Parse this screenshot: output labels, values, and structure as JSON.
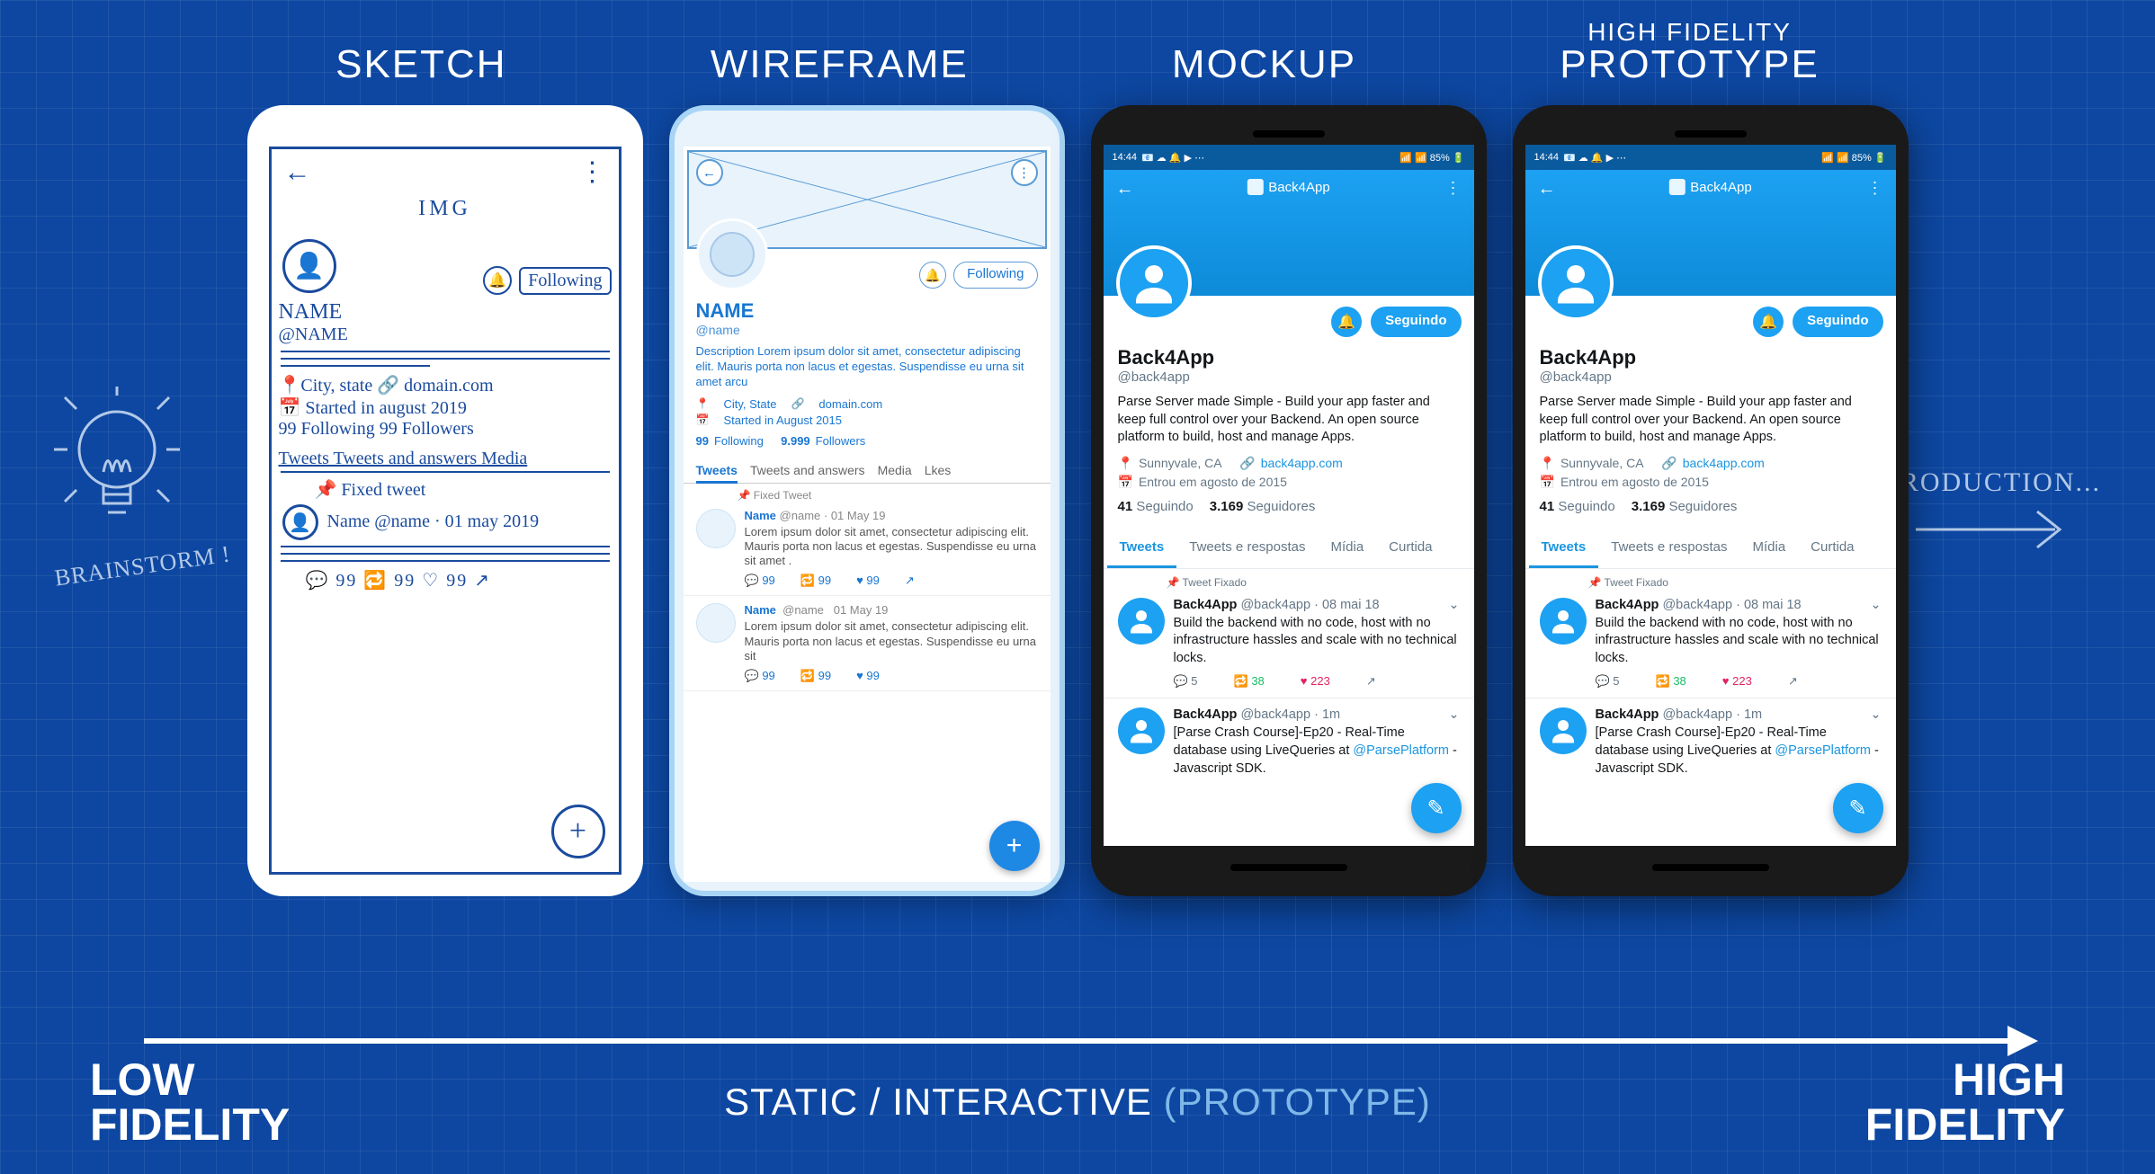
{
  "titles": [
    "SKETCH",
    "WIREFRAME",
    "MOCKUP"
  ],
  "title4_sub": "HIGH FIDELITY",
  "title4_main": "PROTOTYPE",
  "brainstorm_label": "BRAINSTORM !",
  "production_label": "PRODUCTION...",
  "fidelity_low": "LOW\nFIDELITY",
  "fidelity_high": "HIGH\nFIDELITY",
  "mid_static": "STATIC / INTERACTIVE ",
  "mid_proto": "(PROTOTYPE)",
  "sketch": {
    "img": "IMG",
    "name": "NAME",
    "handle": "@NAME",
    "bell": "🔔",
    "follow": "Following",
    "loc": "📍City, state   🔗 domain.com",
    "started": "📅 Started in august 2019",
    "follow_counts": "99 Following   99 Followers",
    "tabs": "Tweets  Tweets and answers  Media",
    "fixed": "📌 Fixed tweet",
    "tweet_meta": "Name  @name · 01 may 2019",
    "stat_row": "💬 99    🔁 99    ♡ 99    ↗"
  },
  "wire": {
    "name": "NAME",
    "handle": "@name",
    "follow": "Following",
    "desc": "Description Lorem ipsum dolor sit amet, consectetur adipiscing elit. Mauris porta non lacus et egestas. Suspendisse eu urna sit amet arcu",
    "loc": "City, State",
    "domain": "domain.com",
    "started": "Started in August 2015",
    "following_n": "99",
    "following_l": "Following",
    "followers_n": "9.999",
    "followers_l": "Followers",
    "tabs": [
      "Tweets",
      "Tweets and answers",
      "Media",
      "Lkes"
    ],
    "fixed": "📌  Fixed Tweet",
    "tweet_name": "Name",
    "tweet_handle": "@name · 01 May 19",
    "tweet_body": "Lorem ipsum dolor sit amet, consectetur adipiscing elit. Mauris porta non lacus et egestas. Suspendisse eu urna sit amet .",
    "tweet_body2": "Lorem ipsum dolor sit amet, consectetur adipiscing elit. Mauris porta non lacus et egestas. Suspendisse eu urna sit",
    "stats": {
      "reply": "99",
      "rt": "99",
      "like": "99"
    }
  },
  "mock": {
    "status_time": "14:44",
    "status_icons_left": "📧 ☁ 🔔 ▶ ⋯",
    "status_icons_right": "📶 📶 85% 🔋",
    "brand": "Back4App",
    "name": "Back4App",
    "handle": "@back4app",
    "follow": "Seguindo",
    "desc": "Parse Server made Simple - Build your app faster and keep full control over your Backend. An open source platform to build, host and manage Apps.",
    "loc": "Sunnyvale, CA",
    "link": "back4app.com",
    "started": "Entrou em agosto de 2015",
    "following_n": "41",
    "following_l": "Seguindo",
    "followers_n": "3.169",
    "followers_l": "Seguidores",
    "tabs": [
      "Tweets",
      "Tweets e respostas",
      "Mídia",
      "Curtida"
    ],
    "fixed": "📌  Tweet Fixado",
    "tweet1": {
      "name": "Back4App",
      "handle": "@back4app · 08 mai 18",
      "body": "Build the backend with no code, host with no infrastructure hassles and scale with no technical locks.",
      "reply": "5",
      "rt": "38",
      "like": "223"
    },
    "tweet2": {
      "name": "Back4App",
      "handle": "@back4app · 1m",
      "body_pre": "[Parse Crash Course]-Ep20 - Real-Time database using LiveQueries at ",
      "mention": "@ParsePlatform",
      "body_post": " - Javascript SDK."
    }
  }
}
